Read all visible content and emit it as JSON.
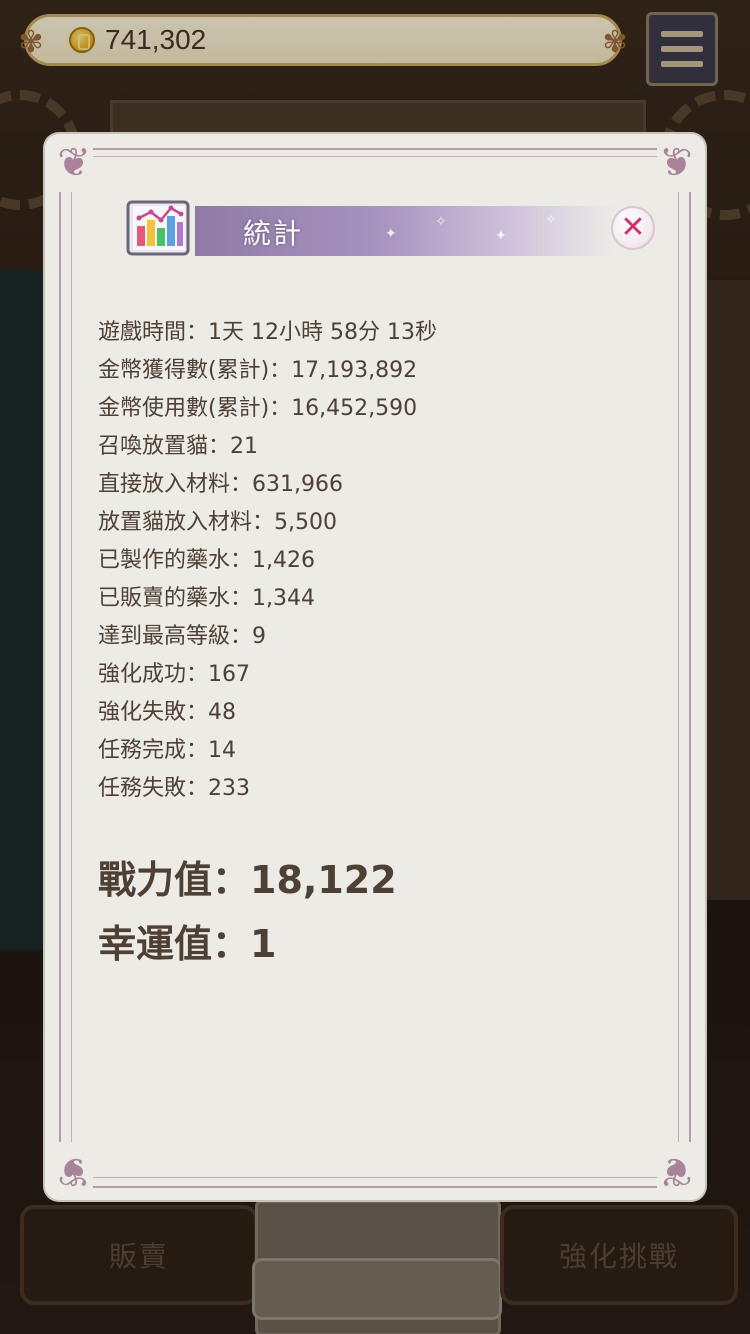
{
  "top_bar": {
    "coin_value": "741,302",
    "coin_icon": "gold-coin-icon",
    "menu_icon": "hamburger-menu-icon"
  },
  "background": {
    "sell_button_label": "販賣",
    "enhance_challenge_button_label": "強化挑戰"
  },
  "dialog": {
    "title": "統計",
    "title_icon": "bar-chart-icon",
    "close_icon": "close-icon",
    "stats": [
      {
        "label": "遊戲時間",
        "value": "1天 12小時 58分 13秒"
      },
      {
        "label": "金幣獲得數(累計)",
        "value": "17,193,892"
      },
      {
        "label": "金幣使用數(累計)",
        "value": "16,452,590"
      },
      {
        "label": "召喚放置貓",
        "value": "21"
      },
      {
        "label": "直接放入材料",
        "value": "631,966"
      },
      {
        "label": "放置貓放入材料",
        "value": "5,500"
      },
      {
        "label": "已製作的藥水",
        "value": "1,426"
      },
      {
        "label": "已販賣的藥水",
        "value": "1,344"
      },
      {
        "label": "達到最高等級",
        "value": "9"
      },
      {
        "label": "強化成功",
        "value": "167"
      },
      {
        "label": "強化失敗",
        "value": "48"
      },
      {
        "label": "任務完成",
        "value": "14"
      },
      {
        "label": "任務失敗",
        "value": "233"
      }
    ],
    "separator": "：",
    "power_label": "戰力值",
    "power_value": "18,122",
    "luck_label": "幸運值",
    "luck_value": "1"
  },
  "colors": {
    "dialog_bg": "#ecebe6",
    "frame": "#b89aaa",
    "banner": "#a894c0",
    "text": "#4e4035",
    "close_x": "#d1316f"
  }
}
